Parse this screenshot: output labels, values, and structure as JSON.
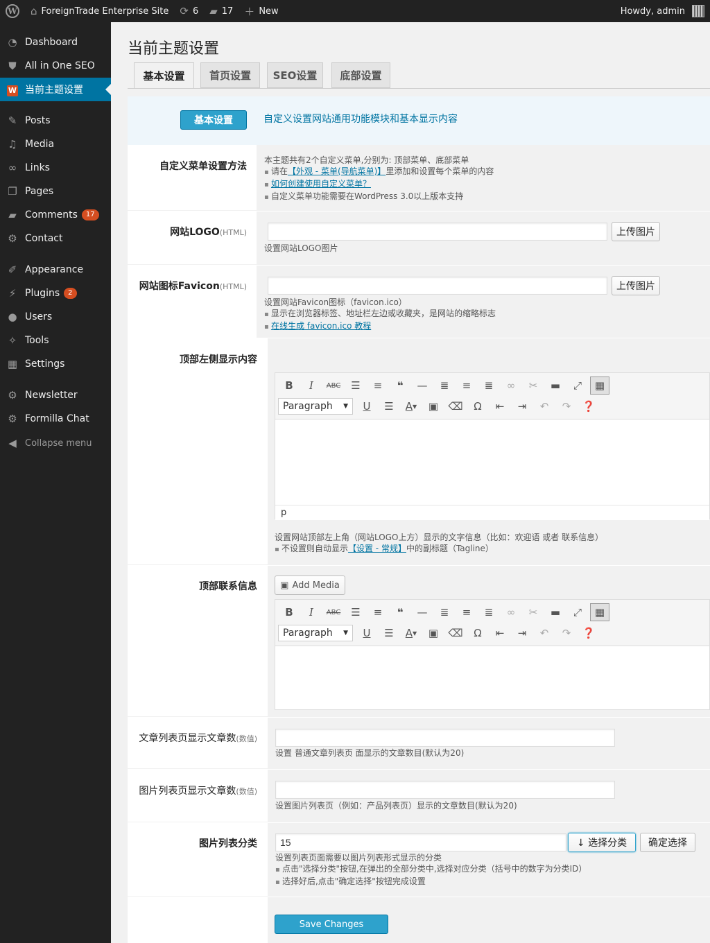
{
  "adminbar": {
    "site_name": "ForeignTrade Enterprise Site",
    "updates_count": "6",
    "comments_count": "17",
    "new_label": "New",
    "howdy": "Howdy, admin"
  },
  "sidebar": {
    "items": [
      {
        "label": "Dashboard"
      },
      {
        "label": "All in One SEO"
      },
      {
        "label": "当前主题设置"
      },
      {
        "label": "Posts"
      },
      {
        "label": "Media"
      },
      {
        "label": "Links"
      },
      {
        "label": "Pages"
      },
      {
        "label": "Comments",
        "badge": "17"
      },
      {
        "label": "Contact"
      },
      {
        "label": "Appearance"
      },
      {
        "label": "Plugins",
        "badge": "2"
      },
      {
        "label": "Users"
      },
      {
        "label": "Tools"
      },
      {
        "label": "Settings"
      },
      {
        "label": "Newsletter"
      },
      {
        "label": "Formilla Chat"
      },
      {
        "label": "Collapse menu"
      }
    ]
  },
  "page": {
    "title": "当前主题设置",
    "tabs": [
      {
        "label": "基本设置"
      },
      {
        "label": "首页设置"
      },
      {
        "label": "SEO设置"
      },
      {
        "label": "底部设置"
      }
    ]
  },
  "section_header": {
    "button": "基本设置",
    "description": "自定义设置网站通用功能模块和基本显示内容"
  },
  "rows": {
    "menu": {
      "label": "自定义菜单设置方法",
      "line1": "本主题共有2个自定义菜单,分别为: 顶部菜单、底部菜单",
      "line2_pre": "请在",
      "line2_link": "【外观 - 菜单(导航菜单)】",
      "line2_post": "里添加和设置每个菜单的内容",
      "line3_link": "如何创建使用自定义菜单？",
      "line4": "自定义菜单功能需要在WordPress 3.0以上版本支持"
    },
    "logo": {
      "label": "网站LOGO",
      "label_small": "(HTML)",
      "value": "",
      "button": "上传图片",
      "desc": "设置网站LOGO图片"
    },
    "favicon": {
      "label": "网站图标Favicon",
      "label_small": "(HTML)",
      "value": "",
      "button": "上传图片",
      "desc1": "设置网站Favicon图标（favicon.ico）",
      "desc2": "显示在浏览器标签、地址栏左边或收藏夹，是网站的缩略标志",
      "desc3_link": "在线生成 favicon.ico 教程"
    },
    "top_left": {
      "label": "顶部左侧显示内容",
      "paragraph": "Paragraph",
      "status": "p",
      "desc1": "设置网站顶部左上角（网站LOGO上方）显示的文字信息（比如：欢迎语 或者 联系信息）",
      "desc2_pre": "不设置则自动显示",
      "desc2_link": "【设置 - 常规】",
      "desc2_post": "中的副标题（Tagline）"
    },
    "top_contact": {
      "label": "顶部联系信息",
      "add_media": "Add Media",
      "paragraph": "Paragraph"
    },
    "post_count": {
      "label": "文章列表页显示文章数",
      "label_small": "(数值)",
      "value": "",
      "desc": "设置 普通文章列表页 面显示的文章数目(默认为20)"
    },
    "image_count": {
      "label": "图片列表页显示文章数",
      "label_small": "(数值)",
      "value": "",
      "desc": "设置图片列表页（例如：产品列表页）显示的文章数目(默认为20)"
    },
    "image_cat": {
      "label": "图片列表分类",
      "value": "15",
      "select_button": "↓ 选择分类",
      "confirm_button": "确定选择",
      "desc1": "设置列表页面需要以图片列表形式显示的分类",
      "desc2": "点击\"选择分类\"按钮,在弹出的全部分类中,选择对应分类（括号中的数字为分类ID）",
      "desc3": "选择好后,点击\"确定选择\"按钮完成设置"
    }
  },
  "save_button": "Save Changes"
}
